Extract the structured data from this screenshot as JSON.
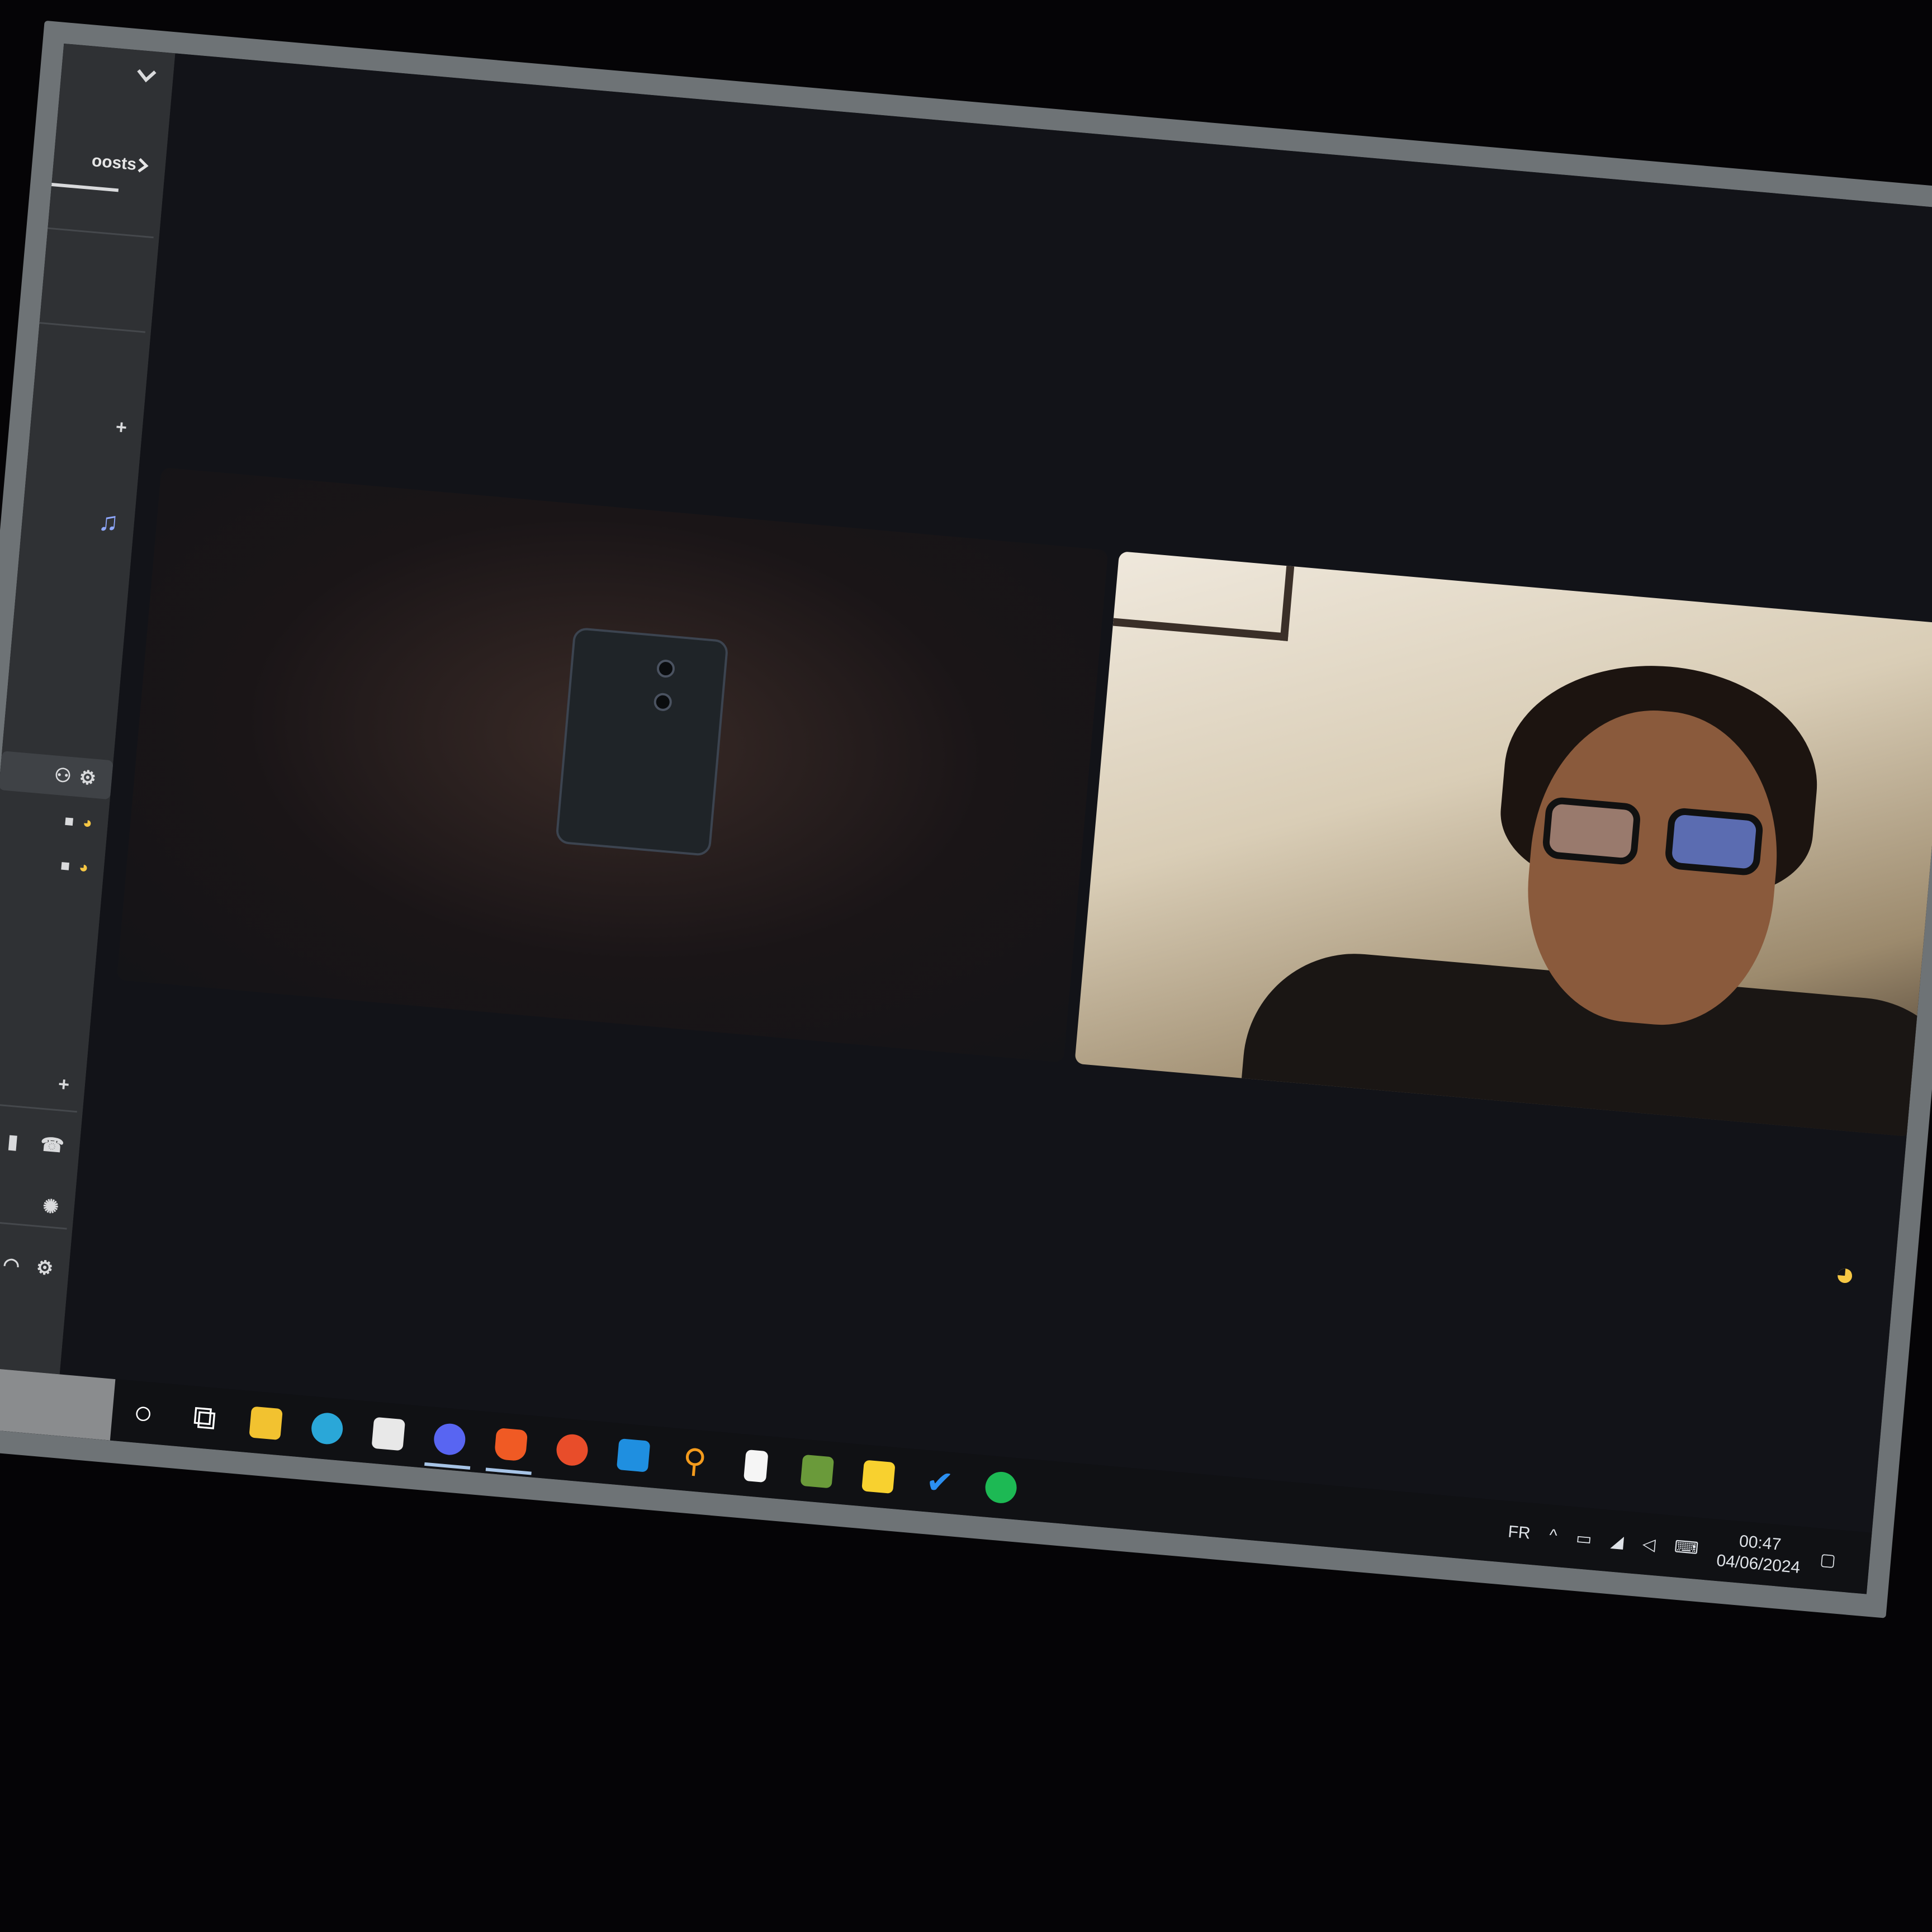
{
  "sidebar": {
    "boosts_label": "oosts",
    "add_channel": "+",
    "add_channel_2": "+"
  },
  "taskbar": {
    "language": "FR",
    "time": "00:47",
    "date": "04/06/2024"
  },
  "colors": {
    "sidebar_bg": "#2f3134",
    "discord_blurple": "#5865f2",
    "spotify_green": "#1db954"
  },
  "icons": [
    "chevron-down-icon",
    "chevron-right-icon",
    "plus-icon",
    "music-note-icon",
    "add-member-icon",
    "gear-icon",
    "video-icon",
    "emoji-icon",
    "voice-signal-icon",
    "hang-up-icon",
    "soundboard-icon",
    "headphones-icon",
    "start-icon",
    "task-view-icon",
    "file-explorer-icon",
    "edge-icon",
    "store-icon",
    "discord-icon",
    "brave-icon",
    "wps-icon",
    "mail-icon",
    "search-icon",
    "notepad-icon",
    "minecraft-icon",
    "sticky-notes-icon",
    "todo-icon",
    "spotify-icon",
    "chevron-up-icon",
    "battery-icon",
    "wifi-icon",
    "volume-icon",
    "keyboard-icon",
    "notification-icon"
  ]
}
